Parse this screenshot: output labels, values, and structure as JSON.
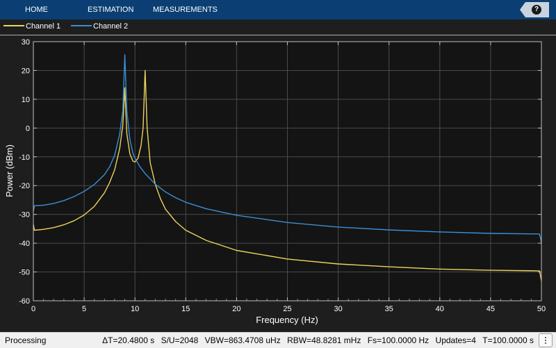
{
  "toolstrip": {
    "tabs": [
      {
        "label": "HOME"
      },
      {
        "label": "ESTIMATION"
      },
      {
        "label": "MEASUREMENTS"
      }
    ],
    "help_label": "?"
  },
  "legend": {
    "items": [
      {
        "label": "Channel 1",
        "color": "#edd45e"
      },
      {
        "label": "Channel 2",
        "color": "#3a8fd9"
      }
    ]
  },
  "chart_data": {
    "type": "line",
    "title": "",
    "xlabel": "Frequency (Hz)",
    "ylabel": "Power (dBm)",
    "xlim": [
      0,
      50
    ],
    "ylim": [
      -60,
      30
    ],
    "xticks": [
      0,
      5,
      10,
      15,
      20,
      25,
      30,
      35,
      40,
      45,
      50
    ],
    "yticks": [
      -60,
      -50,
      -40,
      -30,
      -20,
      -10,
      0,
      10,
      20,
      30
    ],
    "xtick_labels": [
      "0",
      "5",
      "10",
      "15",
      "20",
      "25",
      "30",
      "35",
      "40",
      "45",
      "50"
    ],
    "ytick_labels": [
      "-60",
      "-50",
      "-40",
      "-30",
      "-20",
      "-10",
      "0",
      "10",
      "20",
      "30"
    ],
    "grid": true,
    "background": "#141414",
    "series": [
      {
        "name": "Channel 1",
        "color": "#edd45e",
        "x": [
          0,
          0.1,
          1,
          2,
          3,
          4,
          5,
          6,
          7,
          7.5,
          8,
          8.5,
          8.8,
          9.0,
          9.2,
          9.5,
          9.8,
          10.0,
          10.3,
          10.6,
          10.8,
          11.0,
          11.2,
          11.5,
          12,
          12.5,
          13,
          14,
          15,
          17,
          20,
          25,
          30,
          35,
          40,
          45,
          49.8,
          49.9,
          50
        ],
        "y": [
          -33.5,
          -35.5,
          -35.2,
          -34.6,
          -33.6,
          -32.2,
          -30.2,
          -27.2,
          -22.5,
          -19.0,
          -14.5,
          -7.0,
          1.0,
          14.0,
          -2.0,
          -9.0,
          -11.5,
          -11.8,
          -10.5,
          -6.0,
          0.0,
          20.0,
          0.0,
          -12.0,
          -19.5,
          -24.5,
          -28.2,
          -32.5,
          -35.5,
          -39.0,
          -42.5,
          -45.5,
          -47.2,
          -48.2,
          -49.0,
          -49.4,
          -49.6,
          -51.0,
          -53.0
        ]
      },
      {
        "name": "Channel 2",
        "color": "#3a8fd9",
        "x": [
          0,
          0.1,
          1,
          2,
          3,
          4,
          5,
          6,
          7,
          7.5,
          8,
          8.5,
          8.8,
          9.0,
          9.2,
          9.5,
          9.8,
          10.0,
          10.5,
          11,
          12,
          13,
          14,
          15,
          17,
          20,
          25,
          30,
          35,
          40,
          45,
          49.8,
          49.9,
          50
        ],
        "y": [
          -29.0,
          -27.0,
          -26.8,
          -26.2,
          -25.2,
          -23.8,
          -22.0,
          -19.6,
          -16.2,
          -13.5,
          -9.5,
          -2.0,
          6.0,
          25.5,
          6.0,
          -4.0,
          -8.8,
          -10.5,
          -13.5,
          -15.8,
          -19.5,
          -22.2,
          -24.2,
          -25.8,
          -28.0,
          -30.3,
          -32.8,
          -34.4,
          -35.4,
          -36.1,
          -36.6,
          -36.8,
          -38.0,
          -40.0
        ]
      }
    ]
  },
  "status": {
    "state": "Processing",
    "fields": [
      "ΔT=20.4800 s",
      "S/U=2048",
      "VBW=863.4708 uHz",
      "RBW=48.8281 mHz",
      "Fs=100.0000 Hz",
      "Updates=4",
      "T=100.0000 s"
    ]
  }
}
